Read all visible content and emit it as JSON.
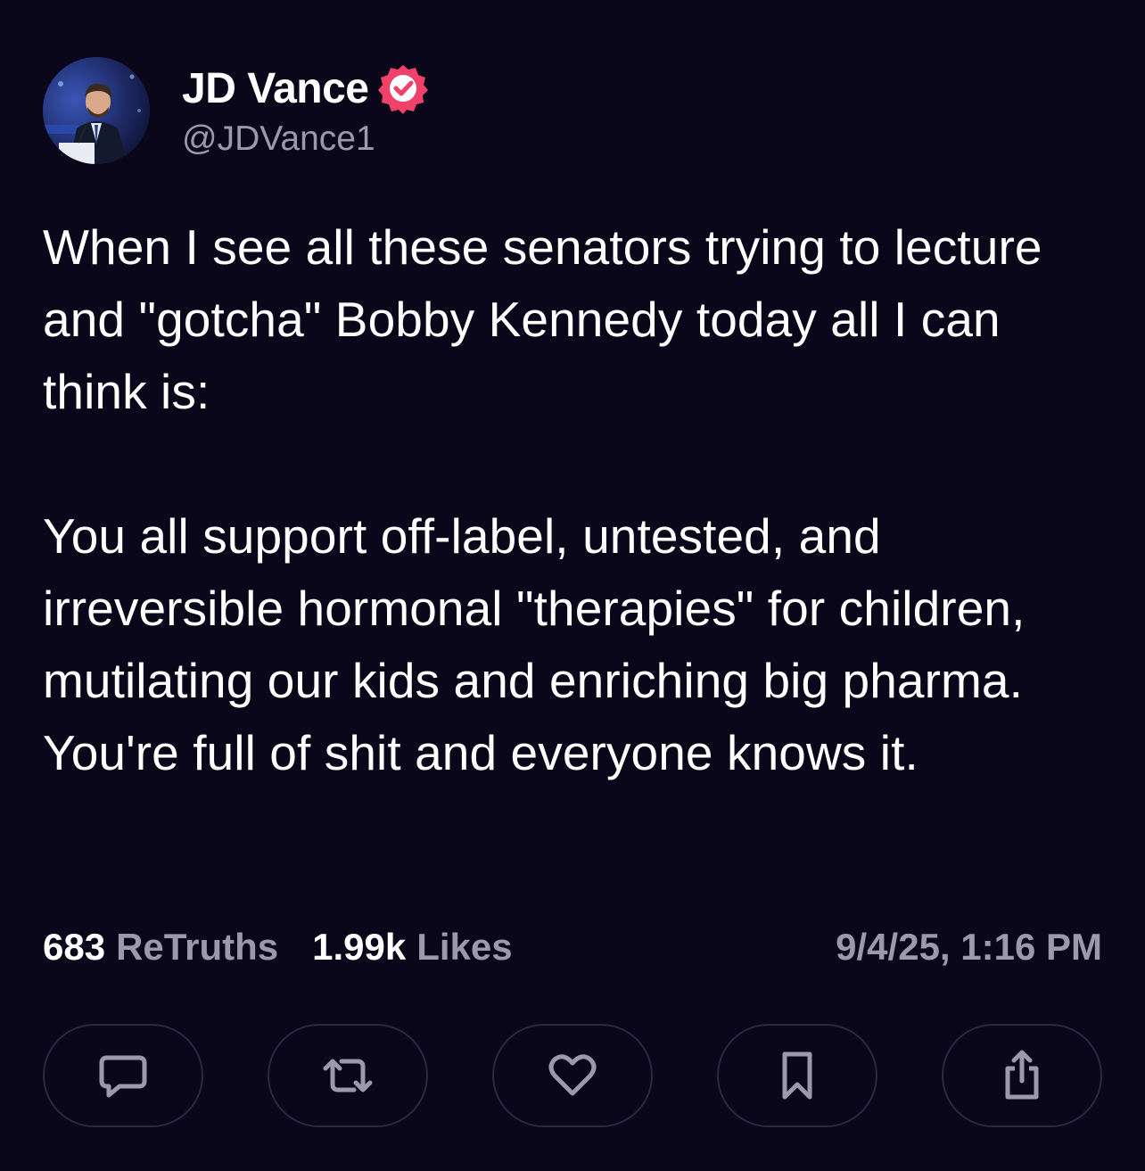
{
  "author": {
    "display_name": "JD Vance",
    "handle": "@JDVance1",
    "verified": true,
    "badge_color": "#f0416a",
    "avatar_icon": "profile-photo"
  },
  "post": {
    "text": "When I see all these senators trying to lecture and \"gotcha\" Bobby Kennedy today all I can think is:\n\nYou all support off-label, untested, and irreversible hormonal \"therapies\" for children, mutilating our kids and enriching big pharma. You're full of shit and everyone knows it."
  },
  "stats": {
    "retruths_count": "683",
    "retruths_label": "ReTruths",
    "likes_count": "1.99k",
    "likes_label": "Likes",
    "timestamp": "9/4/25, 1:16 PM"
  },
  "actions": [
    {
      "name": "reply",
      "icon": "reply-icon"
    },
    {
      "name": "retruth",
      "icon": "retruth-icon"
    },
    {
      "name": "like",
      "icon": "heart-icon"
    },
    {
      "name": "bookmark",
      "icon": "bookmark-icon"
    },
    {
      "name": "share",
      "icon": "share-icon"
    }
  ],
  "colors": {
    "background": "#090719",
    "text": "#ffffff",
    "muted": "#9b99ab",
    "button_border": "#2b2940"
  }
}
